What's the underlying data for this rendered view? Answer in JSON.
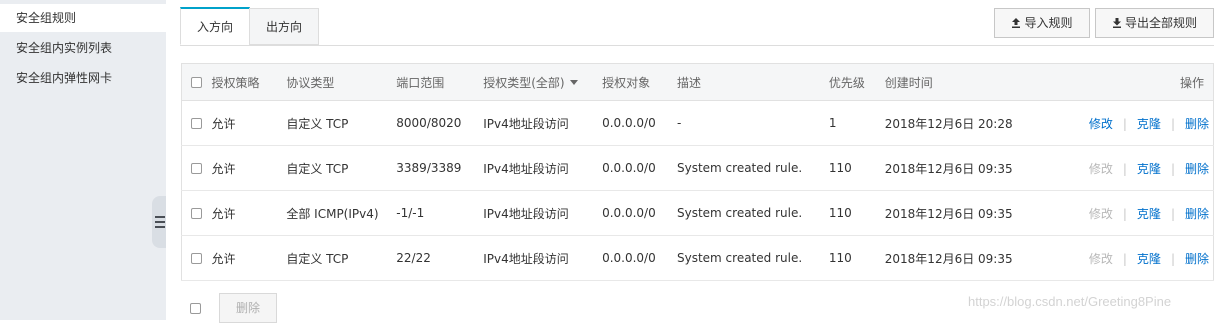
{
  "sidebar": {
    "items": [
      {
        "label": "安全组规则",
        "active": true
      },
      {
        "label": "安全组内实例列表",
        "active": false
      },
      {
        "label": "安全组内弹性网卡",
        "active": false
      }
    ]
  },
  "tabs": [
    {
      "label": "入方向",
      "active": true
    },
    {
      "label": "出方向",
      "active": false
    }
  ],
  "toolbar": {
    "import_label": "导入规则",
    "export_label": "导出全部规则"
  },
  "table": {
    "headers": {
      "policy": "授权策略",
      "protocol": "协议类型",
      "port": "端口范围",
      "auth_type": "授权类型(全部)",
      "target": "授权对象",
      "desc": "描述",
      "priority": "优先级",
      "created": "创建时间",
      "actions": "操作"
    },
    "rows": [
      {
        "policy": "允许",
        "protocol": "自定义 TCP",
        "port": "8000/8020",
        "auth_type": "IPv4地址段访问",
        "target": "0.0.0.0/0",
        "desc": "-",
        "priority": "1",
        "created": "2018年12月6日 20:28",
        "edit": "修改",
        "edit_enabled": true,
        "clone": "克隆",
        "delete": "删除"
      },
      {
        "policy": "允许",
        "protocol": "自定义 TCP",
        "port": "3389/3389",
        "auth_type": "IPv4地址段访问",
        "target": "0.0.0.0/0",
        "desc": "System created rule.",
        "priority": "110",
        "created": "2018年12月6日 09:35",
        "edit": "修改",
        "edit_enabled": false,
        "clone": "克隆",
        "delete": "删除"
      },
      {
        "policy": "允许",
        "protocol": "全部 ICMP(IPv4)",
        "port": "-1/-1",
        "auth_type": "IPv4地址段访问",
        "target": "0.0.0.0/0",
        "desc": "System created rule.",
        "priority": "110",
        "created": "2018年12月6日 09:35",
        "edit": "修改",
        "edit_enabled": false,
        "clone": "克隆",
        "delete": "删除"
      },
      {
        "policy": "允许",
        "protocol": "自定义 TCP",
        "port": "22/22",
        "auth_type": "IPv4地址段访问",
        "target": "0.0.0.0/0",
        "desc": "System created rule.",
        "priority": "110",
        "created": "2018年12月6日 09:35",
        "edit": "修改",
        "edit_enabled": false,
        "clone": "克隆",
        "delete": "删除"
      }
    ]
  },
  "footer": {
    "delete_label": "删除"
  },
  "watermark": "https://blog.csdn.net/Greeting8Pine",
  "colors": {
    "accent": "#00a2ca",
    "link": "#0070cc",
    "sidebar_bg": "#eaedf1",
    "disabled": "#b8b8b8"
  }
}
